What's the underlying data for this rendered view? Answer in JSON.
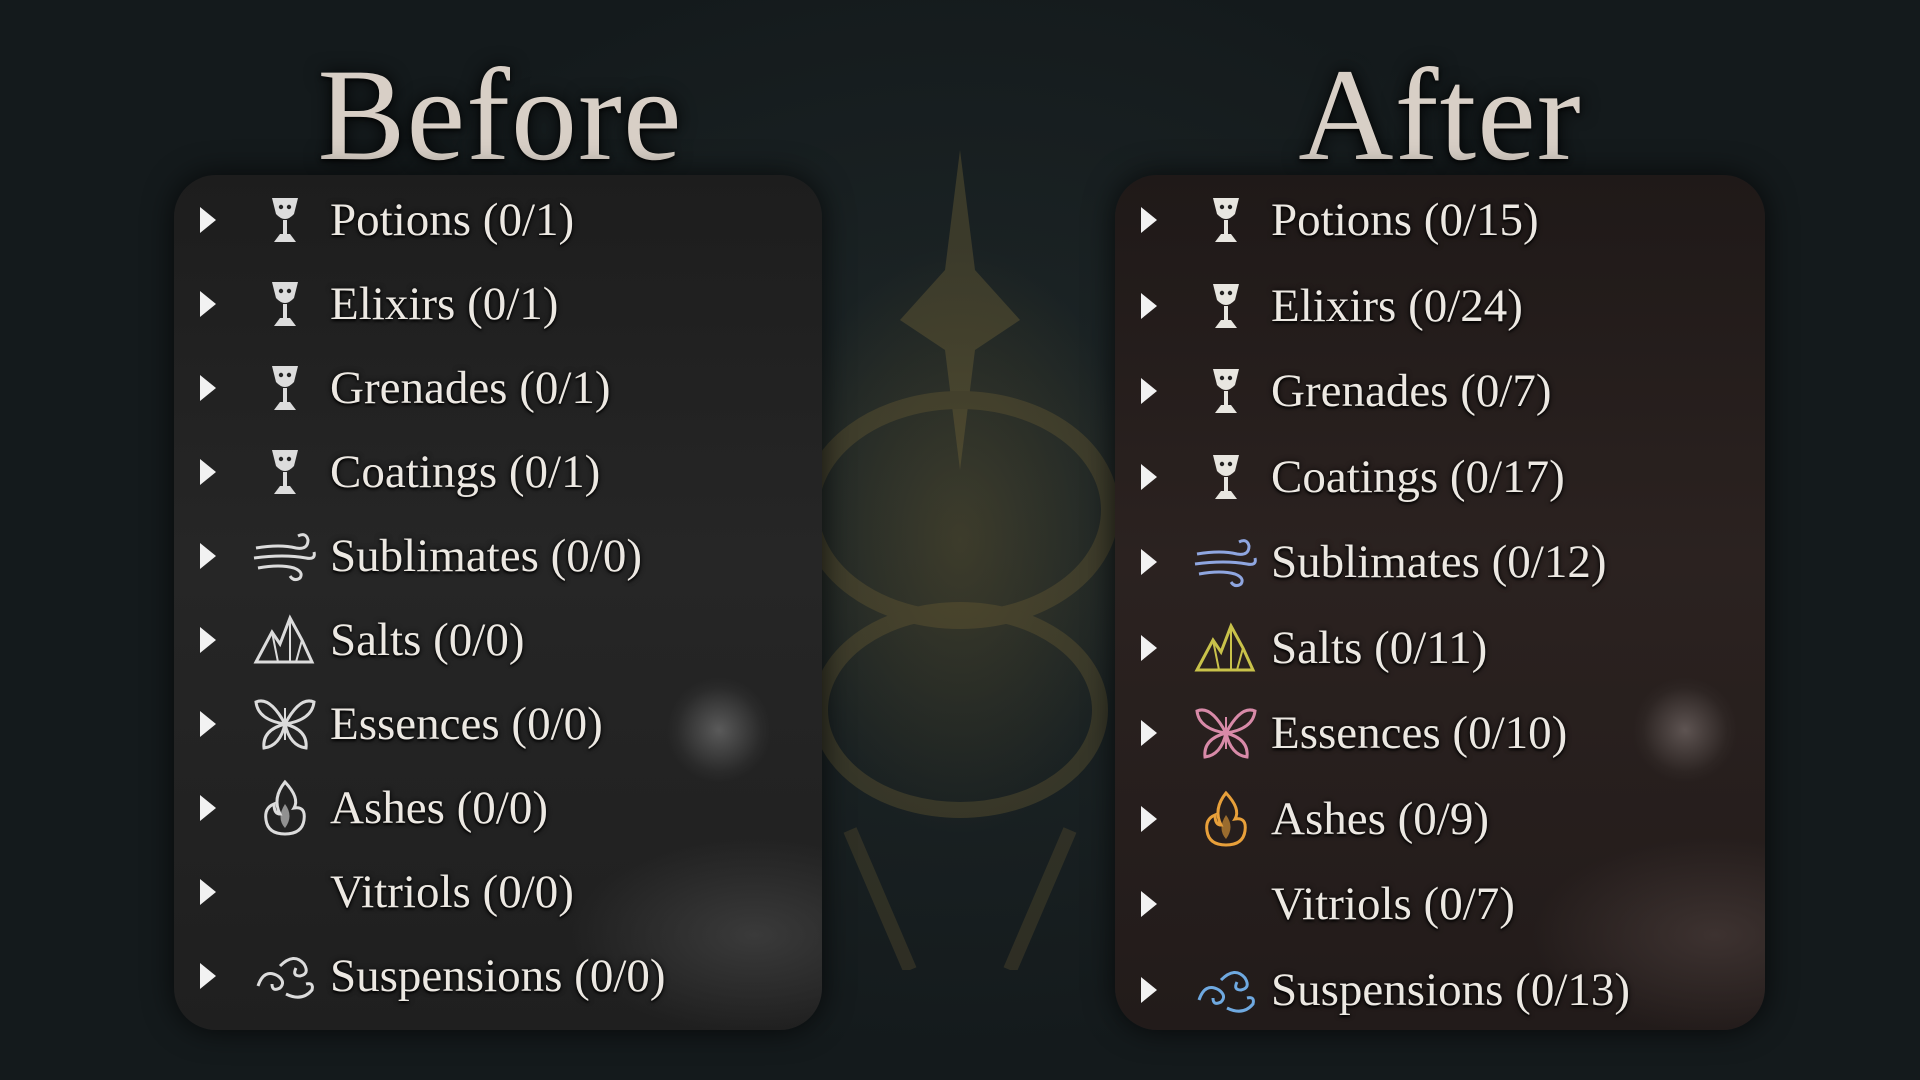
{
  "headings": {
    "before": "Before",
    "after": "After"
  },
  "before": {
    "items": [
      {
        "label": "Potions (0/1)",
        "icon": "chalice-icon"
      },
      {
        "label": "Elixirs (0/1)",
        "icon": "chalice-icon"
      },
      {
        "label": "Grenades (0/1)",
        "icon": "chalice-icon"
      },
      {
        "label": "Coatings (0/1)",
        "icon": "chalice-icon"
      },
      {
        "label": "Sublimates (0/0)",
        "icon": "wind-icon"
      },
      {
        "label": "Salts (0/0)",
        "icon": "crystal-icon"
      },
      {
        "label": "Essences (0/0)",
        "icon": "butterfly-icon"
      },
      {
        "label": "Ashes (0/0)",
        "icon": "flame-icon"
      },
      {
        "label": "Vitriols (0/0)",
        "icon": "crescent-icon"
      },
      {
        "label": "Suspensions (0/0)",
        "icon": "swirl-icon"
      }
    ]
  },
  "after": {
    "items": [
      {
        "label": "Potions (0/15)",
        "icon": "chalice-icon"
      },
      {
        "label": "Elixirs (0/24)",
        "icon": "chalice-icon"
      },
      {
        "label": "Grenades (0/7)",
        "icon": "chalice-icon"
      },
      {
        "label": "Coatings (0/17)",
        "icon": "chalice-icon"
      },
      {
        "label": "Sublimates (0/12)",
        "icon": "wind-icon"
      },
      {
        "label": "Salts (0/11)",
        "icon": "crystal-icon"
      },
      {
        "label": "Essences (0/10)",
        "icon": "butterfly-icon"
      },
      {
        "label": "Ashes (0/9)",
        "icon": "flame-icon"
      },
      {
        "label": "Vitriols (0/7)",
        "icon": "crescent-icon"
      },
      {
        "label": "Suspensions (0/13)",
        "icon": "swirl-icon"
      }
    ]
  },
  "colors": {
    "before_icons": "#dcdcdc",
    "after_wind": "#8fa6e0",
    "after_crystal": "#c9c24a",
    "after_butterfly": "#d88aa8",
    "after_flame": "#e8a03a",
    "after_crescent": "#cfd3de",
    "after_swirl": "#6fa9e0",
    "after_chalice": "#e8e6e0"
  }
}
